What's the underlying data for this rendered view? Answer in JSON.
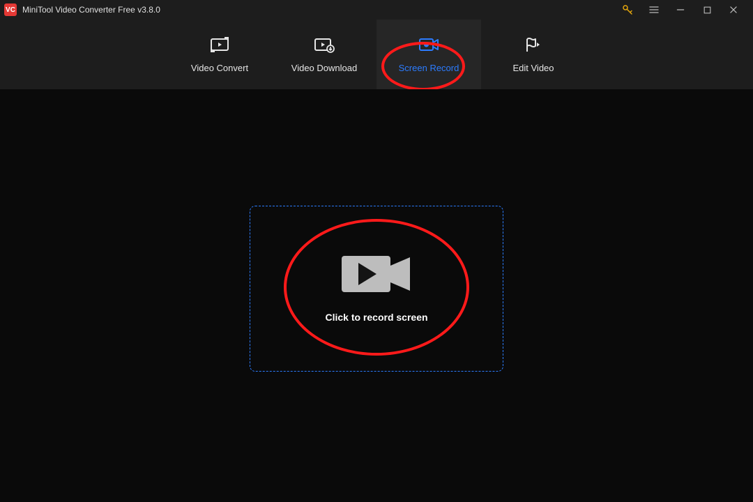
{
  "app": {
    "title": "MiniTool Video Converter Free v3.8.0",
    "logo_text": "VC"
  },
  "titlebar_controls": {
    "key": "key-icon",
    "menu": "menu-icon",
    "minimize": "minimize-icon",
    "maximize": "maximize-icon",
    "close": "close-icon"
  },
  "tabs": [
    {
      "id": "video-convert",
      "label": "Video Convert",
      "active": false
    },
    {
      "id": "video-download",
      "label": "Video Download",
      "active": false
    },
    {
      "id": "screen-record",
      "label": "Screen Record",
      "active": true
    },
    {
      "id": "edit-video",
      "label": "Edit Video",
      "active": false
    }
  ],
  "main": {
    "record_prompt": "Click to record screen"
  },
  "colors": {
    "accent": "#2c7cff",
    "annotation": "#ff1a1a",
    "bg": "#0a0a0a",
    "panel": "#1d1d1d"
  }
}
